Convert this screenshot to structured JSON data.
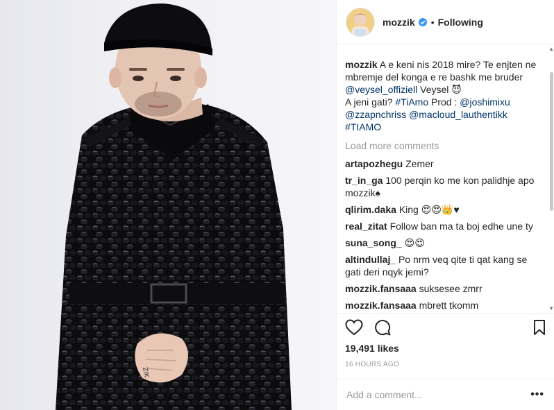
{
  "post": {
    "username": "mozzik",
    "follow_dot": "•",
    "follow_status": "Following",
    "caption": {
      "username": "mozzik",
      "text_1": " A e keni nis 2018 mire? Te enjten ne mbremje del konga e re bashk me bruder ",
      "mention_1": "@veysel_offiziell",
      "text_2": " Veysel 😈",
      "text_3": "A jeni gati? ",
      "hashtag_1": "#TiAmo",
      "text_4": " Prod : ",
      "mention_2": "@joshimixu",
      "mention_3": "@zzapnchriss",
      "mention_4": "@macloud_lauthentikk",
      "hashtag_2": "#TIAMO"
    },
    "load_more": "Load more comments",
    "comments": [
      {
        "user": "artapozhegu",
        "text": "Zemer"
      },
      {
        "user": "tr_in_ga",
        "text": "100 perqin ko me kon palidhje apo mozzik♠"
      },
      {
        "user": "qlirim.daka",
        "text": "King 😍😍👑♥"
      },
      {
        "user": "real_zitat",
        "text": "Follow ban ma ta boj edhe une ty"
      },
      {
        "user": "suna_song_",
        "text": "😍😍"
      },
      {
        "user": "altindullaj_",
        "text": "Po nrm veq qite ti qat kang se gati deri nqyk jemi?"
      },
      {
        "user": "mozzik.fansaaa",
        "text": "suksesee zmrr"
      },
      {
        "user": "mozzik.fansaaa",
        "text": "mbrett tkomm"
      }
    ],
    "likes": "19,491 likes",
    "time": "16 HOURS AGO",
    "add_comment_placeholder": "Add a comment...",
    "more_options": "•••"
  },
  "icons": {
    "like": "heart-icon",
    "comment": "comment-bubble-icon",
    "save": "bookmark-icon",
    "verified": "verified-badge-icon"
  },
  "colors": {
    "link": "#003569",
    "verified": "#3897f0",
    "muted": "#999999",
    "text": "#262626"
  }
}
